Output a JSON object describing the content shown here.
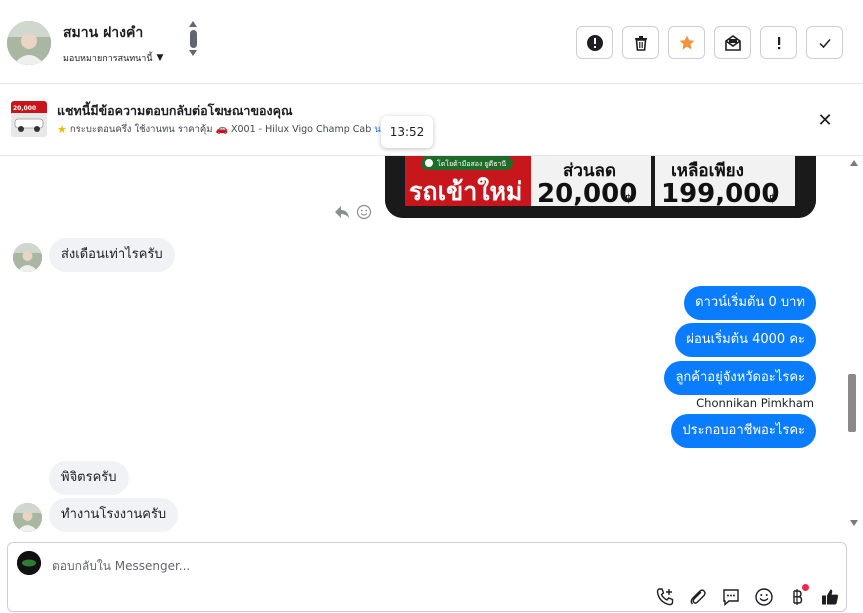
{
  "header": {
    "contact_name": "สมาน ฝางคำ",
    "assign_label": "มอบหมายการสนทนานี้",
    "actions": [
      {
        "name": "spam-button",
        "icon": "alert-circle-icon"
      },
      {
        "name": "delete-button",
        "icon": "trash-icon"
      },
      {
        "name": "star-button",
        "icon": "star-icon",
        "color": "#f7923b"
      },
      {
        "name": "mark-unread-button",
        "icon": "envelope-icon"
      },
      {
        "name": "follow-up-button",
        "icon": "exclamation-icon"
      },
      {
        "name": "done-button",
        "icon": "check-icon"
      }
    ]
  },
  "ad": {
    "title": "แชทนี้มีข้อความตอบกลับต่อโฆษณาของคุณ",
    "subtitle": "กระบะตอนครึ่ง ใช้งานทน ราคาคุ้ม",
    "subtitle_model": "X001 - Hilux Vigo Champ Cab",
    "subtitle_link": "นา",
    "thumb_price": "20,000"
  },
  "tooltip_time": "13:52",
  "promo": {
    "brand": "โตโยต้ามือสอง ยูดีธานี",
    "headline": "รถเข้าใหม่",
    "discount_label": "ส่วนลด",
    "discount_value": "20,000",
    "price_label": "เหลือเพียง",
    "price_value": "199,000",
    "currency": "฿"
  },
  "messages": [
    {
      "dir": "in",
      "text": "ส่งเดือนเท่าไรครับ"
    },
    {
      "dir": "out",
      "text": "ดาวน์เริ่มต้น 0 บาท"
    },
    {
      "dir": "out",
      "text": "ผ่อนเริ่มต้น 4000 คะ"
    },
    {
      "dir": "out",
      "text": "ลูกค้าอยู่จังหวัดอะไรคะ"
    },
    {
      "dir": "out",
      "text": "ประกอบอาชีพอะไรคะ"
    },
    {
      "dir": "in",
      "text": "พิจิตรครับ"
    },
    {
      "dir": "in",
      "text": "ทำงานโรงงานครับ"
    }
  ],
  "sender_name": "Chonnikan Pimkham",
  "composer": {
    "placeholder": "ตอบกลับใน Messenger..."
  },
  "colors": {
    "outgoing_bubble": "#0a7cff",
    "incoming_bubble": "#f0f2f5",
    "notification_dot": "#f02849"
  }
}
